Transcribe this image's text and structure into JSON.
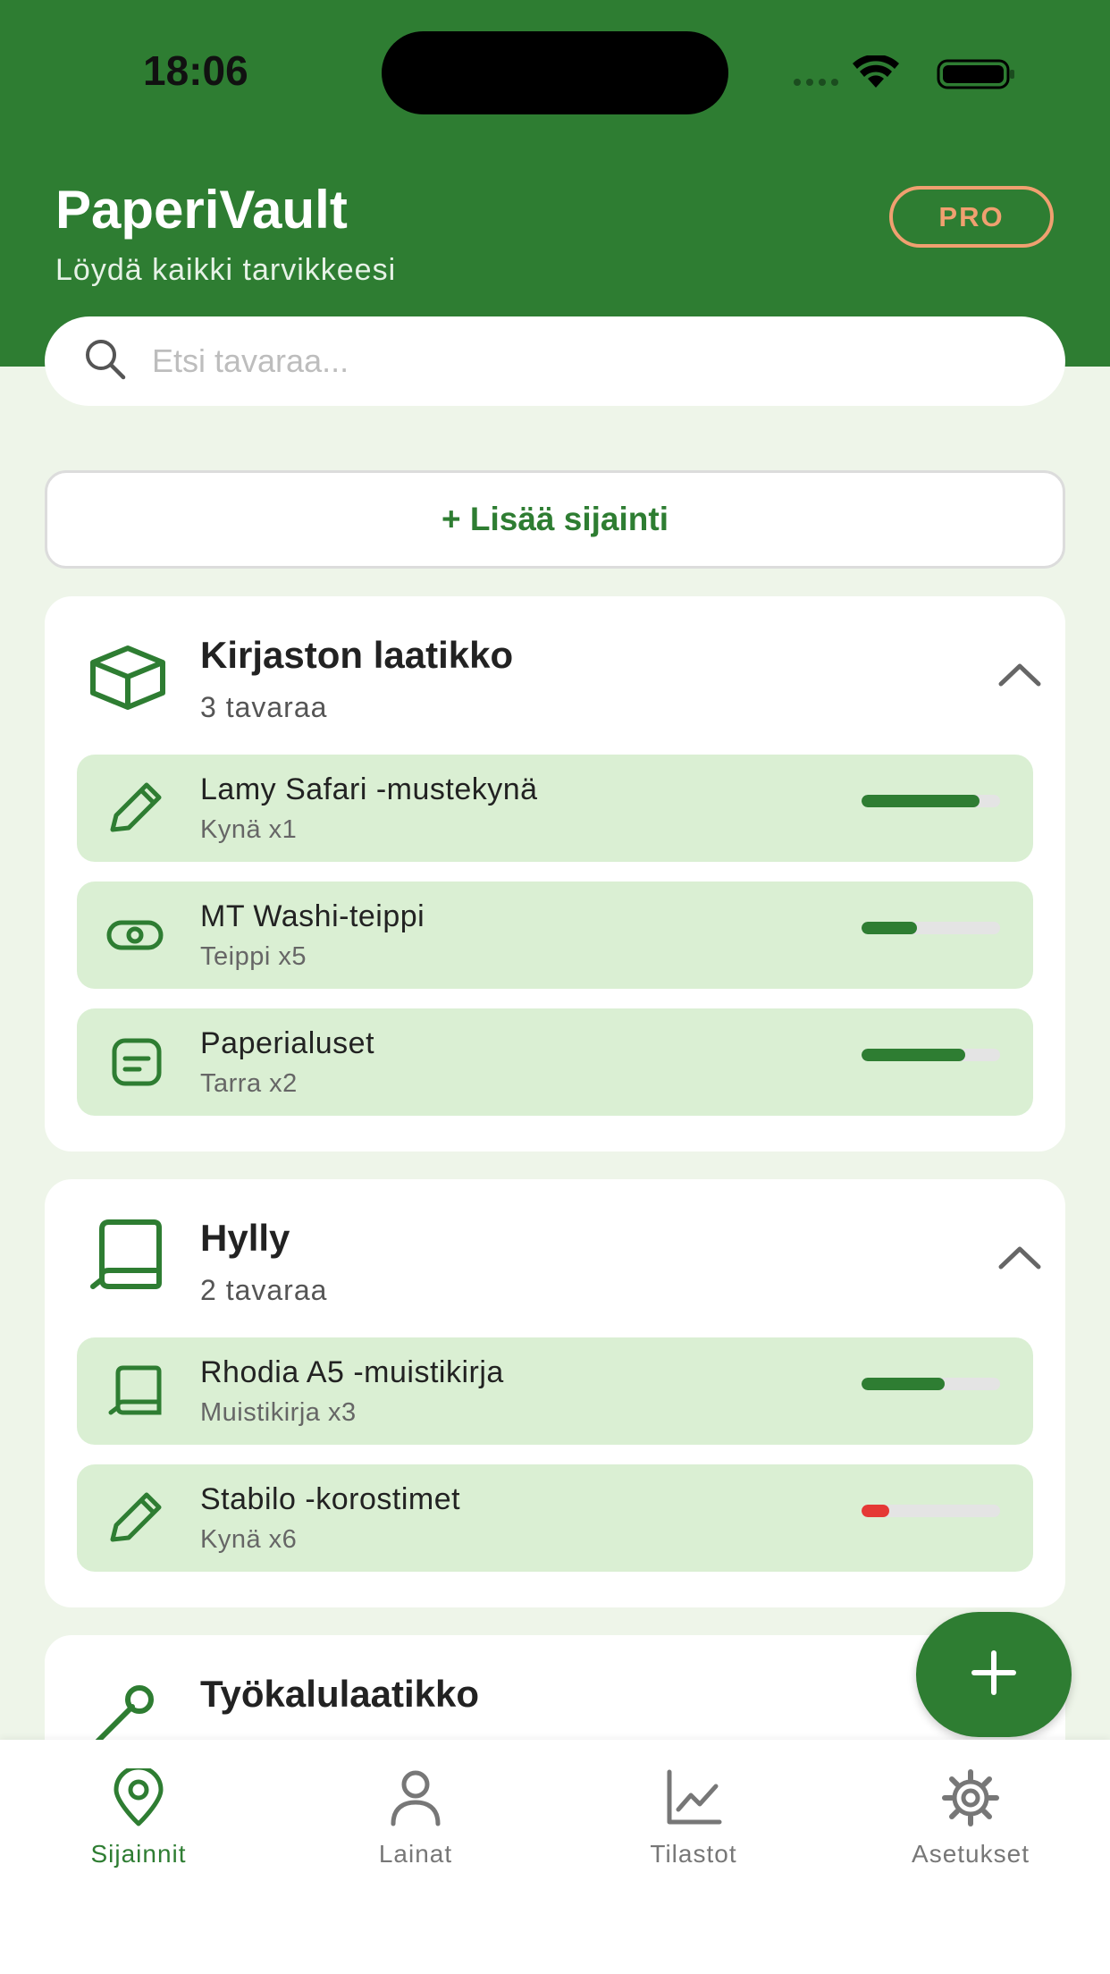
{
  "status_bar": {
    "time": "18:06"
  },
  "header": {
    "title": "PaperiVault",
    "subtitle": "Löydä kaikki tarvikkeesi",
    "badge": "PRO"
  },
  "search": {
    "placeholder": "Etsi tavaraa...",
    "value": ""
  },
  "add_location_label": "+ Lisää sijainti",
  "colors": {
    "primary": "#2e7d32",
    "item_bg": "#daefd3",
    "badge": "#f0a070",
    "low_stock": "#e53935"
  },
  "locations": [
    {
      "name": "Kirjaston laatikko",
      "count": "3 tavaraa",
      "icon": "box-icon",
      "expanded": true,
      "items": [
        {
          "name": "Lamy Safari -mustekynä",
          "sub": "Kynä x1",
          "icon": "pencil-icon",
          "level": 0.85,
          "color": "#2e7d32"
        },
        {
          "name": "MT Washi-teippi",
          "sub": "Teippi x5",
          "icon": "tape-icon",
          "level": 0.4,
          "color": "#2e7d32"
        },
        {
          "name": "Paperialuset",
          "sub": "Tarra x2",
          "icon": "sticker-icon",
          "level": 0.75,
          "color": "#2e7d32"
        }
      ]
    },
    {
      "name": "Hylly",
      "count": "2 tavaraa",
      "icon": "book-icon",
      "expanded": true,
      "items": [
        {
          "name": "Rhodia A5 -muistikirja",
          "sub": "Muistikirja x3",
          "icon": "notebook-icon",
          "level": 0.6,
          "color": "#2e7d32"
        },
        {
          "name": "Stabilo -korostimet",
          "sub": "Kynä x6",
          "icon": "pencil-icon",
          "level": 0.2,
          "color": "#e53935"
        }
      ]
    },
    {
      "name": "Työkalulaatikko",
      "icon": "tool-icon"
    }
  ],
  "tabs": [
    {
      "label": "Sijainnit",
      "icon": "location-pin-icon",
      "active": true
    },
    {
      "label": "Lainat",
      "icon": "person-icon",
      "active": false
    },
    {
      "label": "Tilastot",
      "icon": "chart-icon",
      "active": false
    },
    {
      "label": "Asetukset",
      "icon": "gear-icon",
      "active": false
    }
  ]
}
